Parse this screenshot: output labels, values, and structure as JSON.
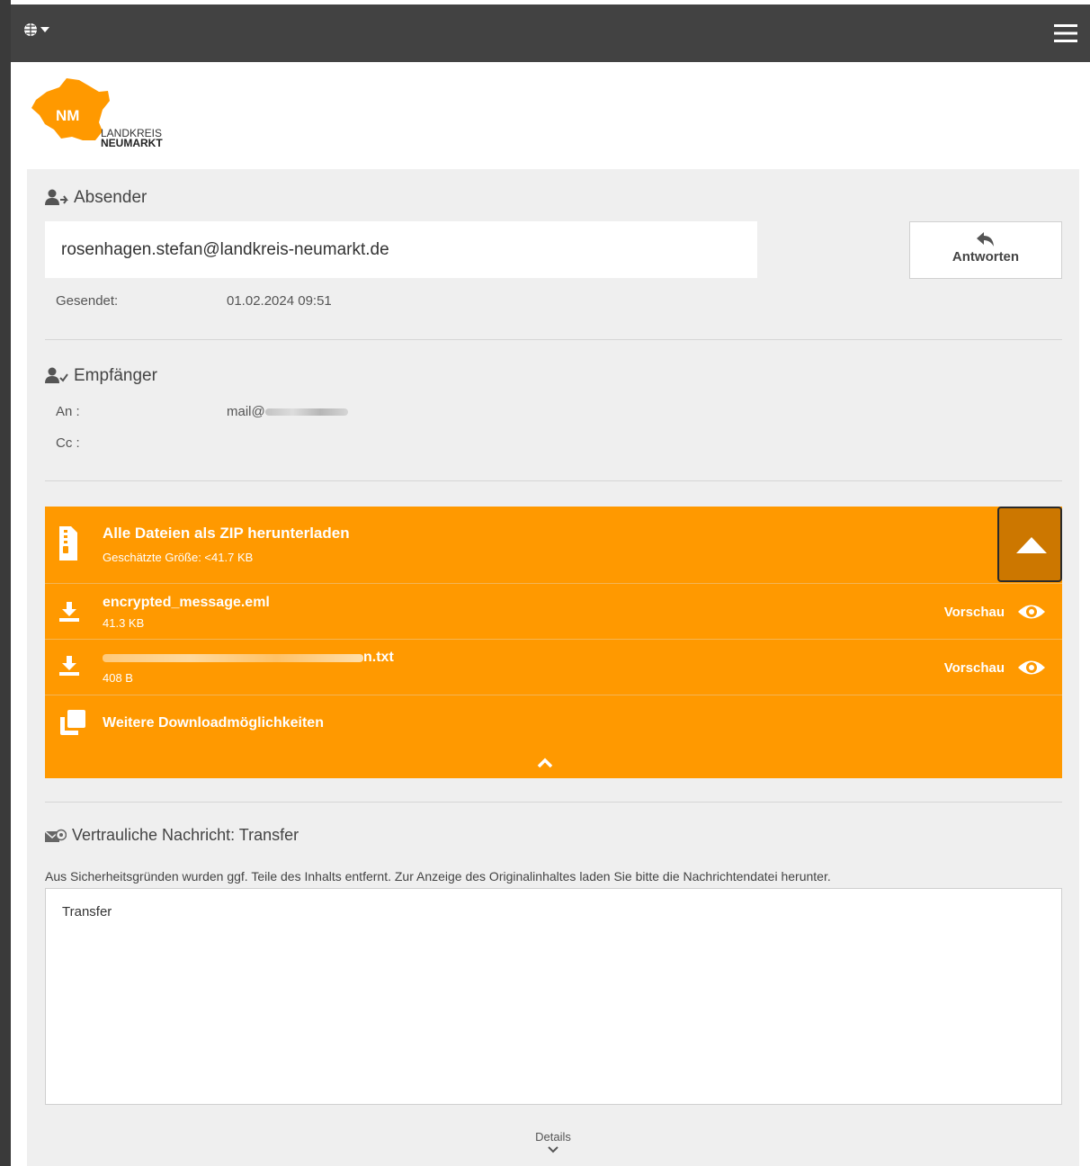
{
  "org": {
    "logo_abbr": "NM",
    "logo_line1": "LANDKREIS",
    "logo_line2": "NEUMARKT",
    "brand_color": "#ff9900"
  },
  "header": {
    "language_icon": "globe-icon",
    "menu_icon": "hamburger-icon"
  },
  "sender": {
    "title": "Absender",
    "email": "rosenhagen.stefan@landkreis-neumarkt.de",
    "reply_label": "Antworten",
    "sent_label": "Gesendet:",
    "sent_value": "01.02.2024 09:51"
  },
  "recipients": {
    "title": "Empfänger",
    "to_label": "An :",
    "to_value": "mail@",
    "cc_label": "Cc :"
  },
  "downloads": {
    "zip_label": "Alle Dateien als ZIP herunterladen",
    "zip_size": "Geschätzte Größe: <41.7 KB",
    "files": [
      {
        "name": "encrypted_message.eml",
        "size": "41.3 KB",
        "preview": "Vorschau"
      },
      {
        "name": "n.txt",
        "size": "408 B",
        "preview": "Vorschau"
      }
    ],
    "more_label": "Weitere Downloadmöglichkeiten"
  },
  "message": {
    "title": "Vertrauliche Nachricht: Transfer",
    "notice": "Aus Sicherheitsgründen wurden ggf. Teile des Inhalts entfernt. Zur Anzeige des Originalinhaltes laden Sie bitte die Nachrichtendatei herunter.",
    "body": "Transfer"
  },
  "footer": {
    "details_label": "Details"
  }
}
